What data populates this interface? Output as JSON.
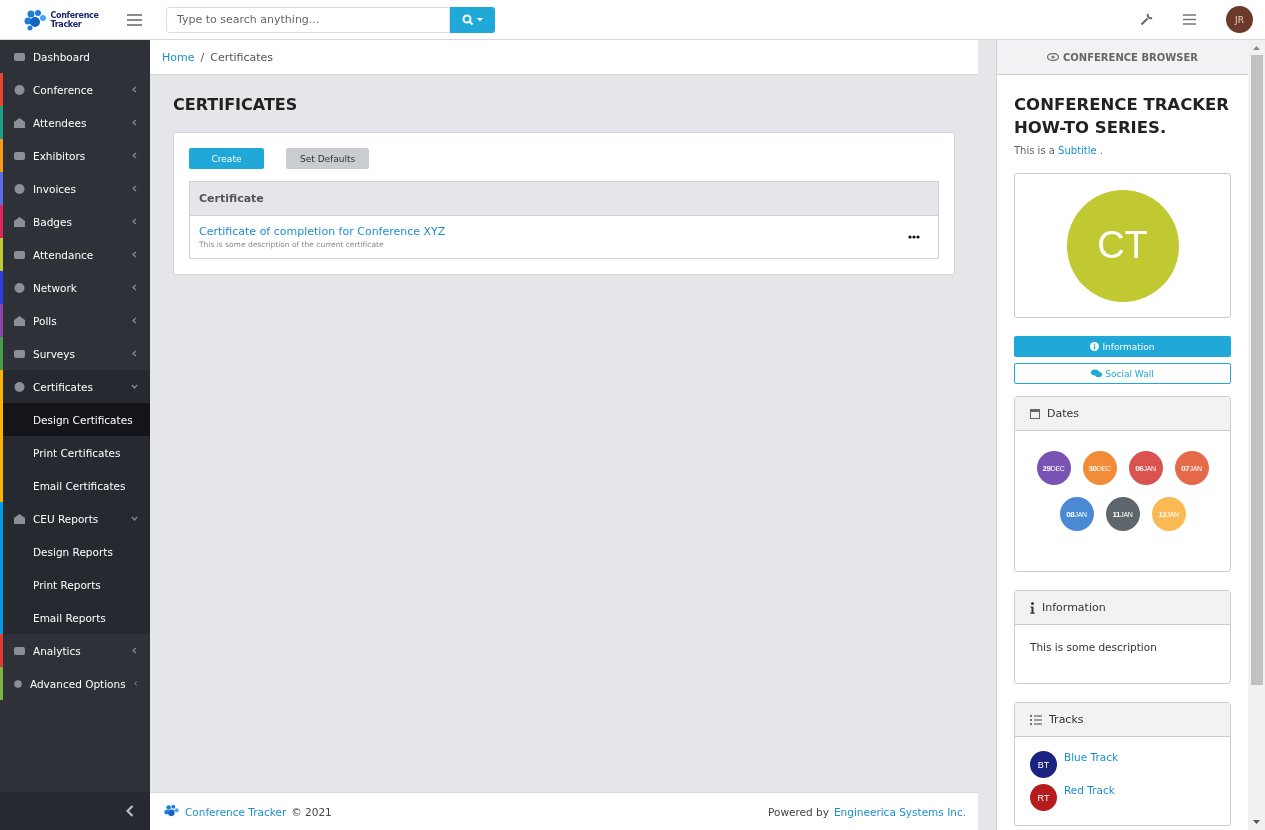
{
  "header": {
    "logo_line1": "Conference",
    "logo_line2": "Tracker",
    "search": {
      "placeholder": "Type to search anything..."
    },
    "avatar": "JR"
  },
  "sidebar": {
    "items": [
      {
        "label": "Dashboard",
        "selected": false
      },
      {
        "label": "Conference",
        "selected": false,
        "expanded": false,
        "color": "#e8452c"
      },
      {
        "label": "Attendees",
        "selected": false,
        "expanded": false,
        "color": "#16a085"
      },
      {
        "label": "Exhibitors",
        "selected": false,
        "expanded": false,
        "color": "#f39c12"
      },
      {
        "label": "Invoices",
        "selected": false,
        "expanded": false,
        "color": "#5b6ee8"
      },
      {
        "label": "Badges",
        "selected": false,
        "expanded": false,
        "color": "#e0245e"
      },
      {
        "label": "Attendance",
        "selected": false,
        "expanded": false,
        "color": "#c0ca33"
      },
      {
        "label": "Network",
        "selected": false,
        "expanded": false,
        "color": "#2b3ee8"
      },
      {
        "label": "Polls",
        "selected": false,
        "expanded": false,
        "color": "#8e44ad"
      },
      {
        "label": "Surveys",
        "selected": false,
        "expanded": false,
        "color": "#43a047"
      },
      {
        "label": "Certificates",
        "selected": false,
        "expanded": true,
        "color": "#ffb300",
        "children": [
          {
            "label": "Design Certificates",
            "selected": true
          },
          {
            "label": "Print Certificates",
            "selected": false
          },
          {
            "label": "Email Certificates",
            "selected": false
          }
        ]
      },
      {
        "label": "CEU Reports",
        "selected": false,
        "expanded": true,
        "color": "#039be5",
        "children": [
          {
            "label": "Design Reports",
            "selected": false
          },
          {
            "label": "Print Reports",
            "selected": false
          },
          {
            "label": "Email Reports",
            "selected": false
          }
        ]
      },
      {
        "label": "Analytics",
        "selected": false,
        "expanded": false,
        "color": "#e53935"
      },
      {
        "label": "Advanced Options",
        "selected": false,
        "expanded": false,
        "color": "#7cb342"
      }
    ]
  },
  "breadcrumb": {
    "separator": "/",
    "items": [
      {
        "label": "Home",
        "kind": "link"
      },
      {
        "label": "Certificates",
        "kind": "current"
      }
    ]
  },
  "page": {
    "title": "CERTIFICATES",
    "buttons": [
      {
        "label": "Create",
        "kind": "primary"
      },
      {
        "label": "Set Defaults",
        "kind": "secondary"
      }
    ],
    "table": {
      "columns": [
        "Certificate"
      ],
      "rows": [
        {
          "title": "Certificate of completion for Conference XYZ",
          "description": "This is some description of the current certificate"
        }
      ]
    }
  },
  "footer": {
    "brand": "Conference Tracker",
    "copyright": "© 2021",
    "powered_by": "Powered by",
    "company": "Engineerica Systems Inc."
  },
  "browser": {
    "header": "CONFERENCE BROWSER",
    "title": "CONFERENCE TRACKER HOW-TO SERIES.",
    "subtitle_prefix": "This is a",
    "subtitle_link": "Subtitle",
    "subtitle_suffix": ".",
    "logo_initials": "CT",
    "buttons": [
      {
        "label": "Information",
        "kind": "primary"
      },
      {
        "label": "Social Wall",
        "kind": "outline"
      }
    ],
    "dates_title": "Dates",
    "dates": [
      {
        "day": "29",
        "month": "DEC",
        "color": "#7952b3"
      },
      {
        "day": "30",
        "month": "DEC",
        "color": "#f28c38"
      },
      {
        "day": "06",
        "month": "JAN",
        "color": "#d9534f"
      },
      {
        "day": "07",
        "month": "JAN",
        "color": "#e56a4a"
      },
      {
        "day": "08",
        "month": "JAN",
        "color": "#4a89d4"
      },
      {
        "day": "11",
        "month": "JAN",
        "color": "#5e666c"
      },
      {
        "day": "12",
        "month": "JAN",
        "color": "#fbb954"
      }
    ],
    "info_title": "Information",
    "info_text": "This is some description",
    "tracks_title": "Tracks",
    "tracks": [
      {
        "initials": "BT",
        "name": "Blue Track",
        "color": "#1b2280"
      },
      {
        "initials": "RT",
        "name": "Red Track",
        "color": "#b71c1c"
      }
    ]
  }
}
